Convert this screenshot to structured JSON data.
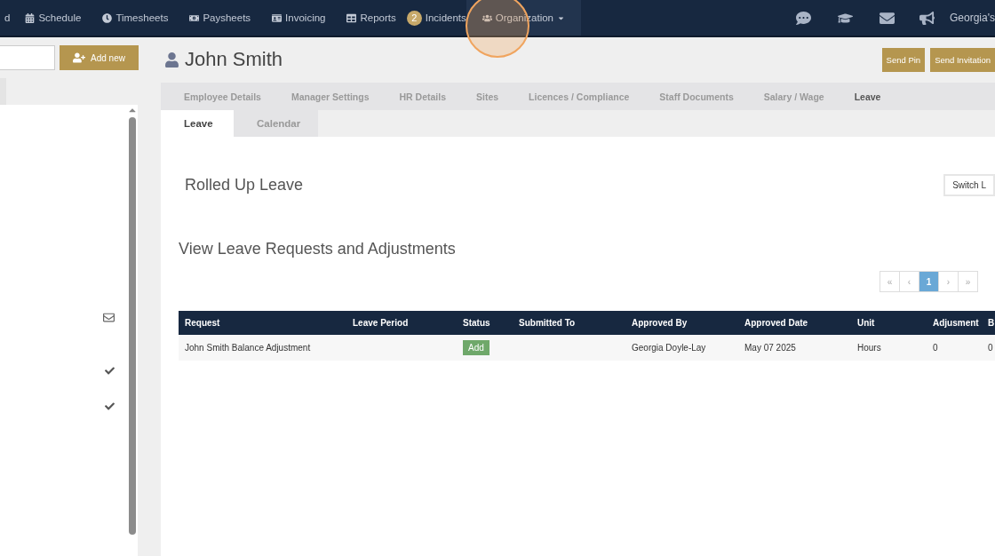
{
  "navbar": {
    "items": [
      {
        "label": "d",
        "dropdown": false,
        "highlighted": false
      },
      {
        "label": "Schedule",
        "dropdown": false,
        "highlighted": false
      },
      {
        "label": "Timesheets",
        "dropdown": false,
        "highlighted": false
      },
      {
        "label": "Paysheets",
        "dropdown": false,
        "highlighted": false
      },
      {
        "label": "Invoicing",
        "dropdown": false,
        "highlighted": false
      },
      {
        "label": "Reports",
        "dropdown": false,
        "highlighted": false
      },
      {
        "label": "Incidents",
        "badge": "2",
        "dropdown": false,
        "highlighted": false
      },
      {
        "label": "Organization",
        "dropdown": true,
        "highlighted": true
      }
    ],
    "user": "Georgia's"
  },
  "sidebar": {
    "add_button": "Add new",
    "rows": [
      {
        "kind": "mail"
      },
      {
        "kind": "check"
      },
      {
        "kind": "check"
      }
    ]
  },
  "employee": {
    "name": "John Smith",
    "buttons": [
      "Send Pin",
      "Send Invitation"
    ]
  },
  "tabs": [
    {
      "label": "Employee Details",
      "selected": false
    },
    {
      "label": "Manager Settings",
      "selected": false
    },
    {
      "label": "HR Details",
      "selected": false
    },
    {
      "label": "Sites",
      "selected": false
    },
    {
      "label": "Licences / Compliance",
      "selected": false
    },
    {
      "label": "Staff Documents",
      "selected": false
    },
    {
      "label": "Salary / Wage",
      "selected": false
    },
    {
      "label": "Leave",
      "selected": true
    }
  ],
  "subtabs": [
    {
      "label": "Leave",
      "selected": true
    },
    {
      "label": "Calendar",
      "selected": false
    }
  ],
  "rolled_up": {
    "title": "Rolled Up Leave",
    "switch_button": "Switch L"
  },
  "requests": {
    "title": "View Leave Requests and Adjustments",
    "pagination": [
      {
        "label": "«",
        "selected": false
      },
      {
        "label": "‹",
        "selected": false
      },
      {
        "label": "1",
        "selected": true
      },
      {
        "label": "›",
        "selected": false
      },
      {
        "label": "»",
        "selected": false
      }
    ],
    "columns": [
      "Request",
      "Leave Period",
      "Status",
      "Submitted To",
      "Approved By",
      "Approved Date",
      "Unit",
      "Adjusment",
      "B"
    ],
    "rows": [
      {
        "cells": [
          "John Smith Balance Adjustment",
          "",
          {
            "badge": "Add"
          },
          "",
          "Georgia Doyle-Lay",
          "May 07 2025",
          "Hours",
          "0",
          "0"
        ]
      }
    ]
  }
}
